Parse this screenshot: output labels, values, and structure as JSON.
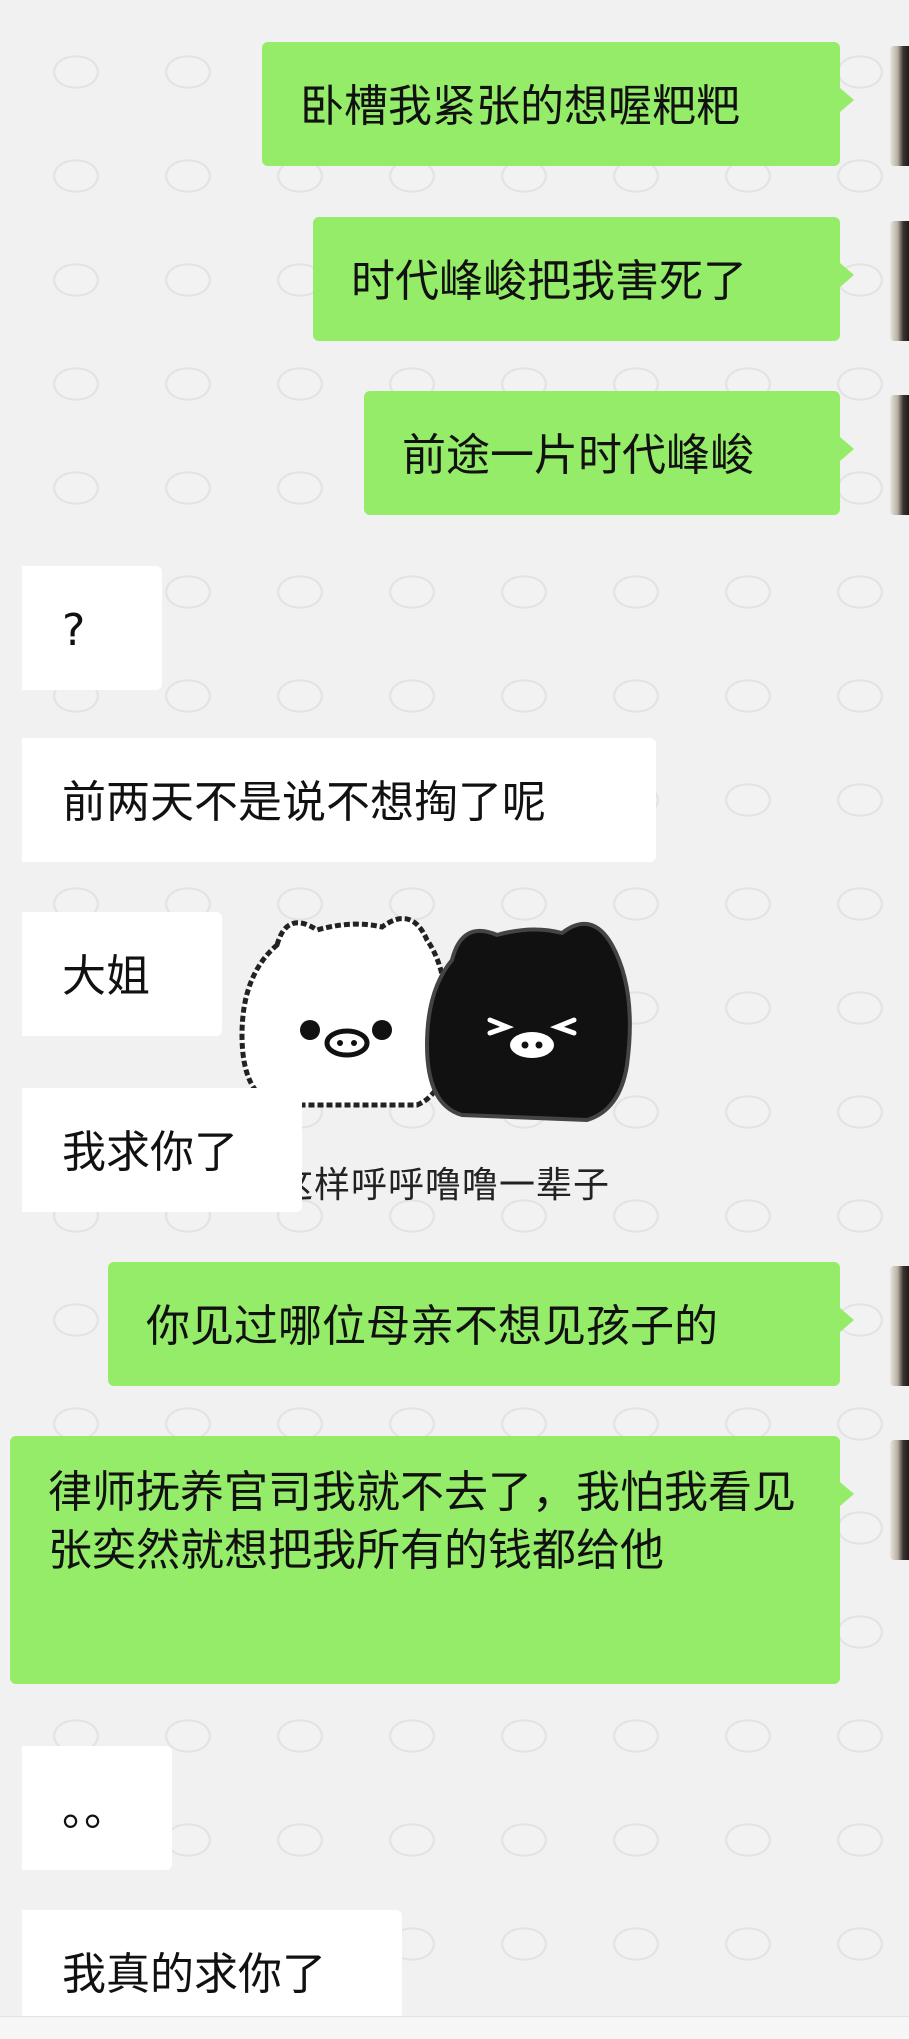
{
  "messages": [
    {
      "from": "me",
      "text": "卧槽我紧张的想喔粑粑"
    },
    {
      "from": "me",
      "text": "时代峰峻把我害死了"
    },
    {
      "from": "me",
      "text": "前途一片时代峰峻"
    },
    {
      "from": "other",
      "text": "?"
    },
    {
      "from": "other",
      "text": "前两天不是说不想掏了呢"
    },
    {
      "from": "other",
      "text": "大姐"
    },
    {
      "from": "other",
      "text": "我求你了"
    },
    {
      "from": "me",
      "text": "你见过哪位母亲不想见孩子的"
    },
    {
      "from": "me",
      "text": "律师抚养官司我就不去了，我怕我看见张奕然就想把我所有的钱都给他"
    },
    {
      "from": "other",
      "text": "。。"
    },
    {
      "from": "other",
      "text": "我真的求你了"
    }
  ],
  "sticker": {
    "icon": "pig-couple-sticker",
    "caption": "就这样呼呼噜噜一辈子"
  },
  "colors": {
    "outgoing_bubble": "#95ec69",
    "incoming_bubble": "#ffffff",
    "background": "#f1f1f1"
  }
}
